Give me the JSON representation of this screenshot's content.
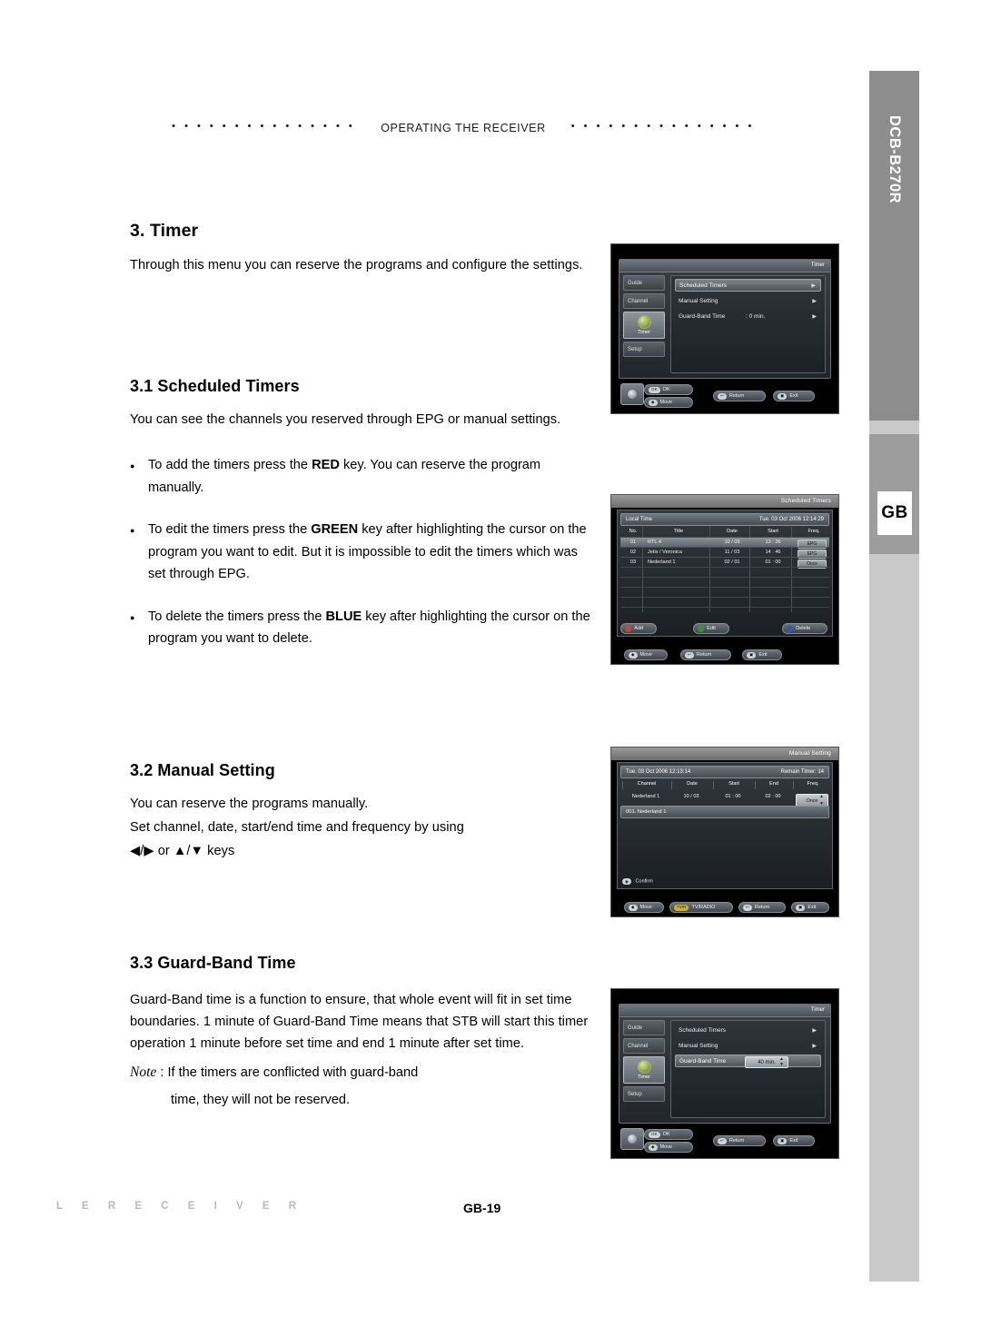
{
  "page": {
    "header_title": "OPERATING THE RECEIVER",
    "header_dots_left": "• • • • • • • • • • • • • • •",
    "header_dots_right": "• • • • • • • • • • • • • • •",
    "model": "DCB-B270R",
    "language_tab": "GB",
    "footer_left": "L  E      R  E  C  E  I  V  E  R",
    "footer_page": "GB-19"
  },
  "sections": {
    "timer": {
      "heading": "3. Timer",
      "body": "Through this menu you can reserve the programs and configure the settings."
    },
    "scheduled": {
      "heading": "3.1 Scheduled Timers",
      "body": "You can see the channels you reserved through EPG or manual settings.",
      "bullets": [
        {
          "pre": "To add the timers press the ",
          "kw": "RED",
          "post": " key. You can reserve the program manually."
        },
        {
          "pre": "To edit the timers press the ",
          "kw": "GREEN",
          "post": " key after highlighting the cursor on the program you want to edit. But it is impossible to edit the timers which was set through EPG."
        },
        {
          "pre": "To delete the timers press the ",
          "kw": "BLUE",
          "post": " key after highlighting the cursor on the program you want to delete."
        }
      ]
    },
    "manual": {
      "heading": "3.2 Manual Setting",
      "body1": "You can reserve the programs manually.",
      "body2": "Set channel, date, start/end time and frequency by using",
      "body3_keys": "◀/▶ or ▲/▼ keys"
    },
    "guard": {
      "heading": "3.3 Guard-Band Time",
      "body": "Guard-Band time is a function to ensure, that whole event will fit in set time boundaries. 1 minute of Guard-Band Time means that STB will start this timer operation 1 minute before set time and end 1 minute after set time.",
      "note_label": "Note",
      "note_colon": ":",
      "note_text": "If the timers are conflicted with guard-band",
      "note_text2": "time, they will not be reserved."
    }
  },
  "screenshots": {
    "timer_menu": {
      "window_title": "Timer",
      "tabs": [
        {
          "label": "Guide"
        },
        {
          "label": "Channel"
        },
        {
          "label": "Timer"
        },
        {
          "label": "Setup"
        }
      ],
      "rows": [
        {
          "label": "Scheduled Timers",
          "value": "",
          "arrow": "▶"
        },
        {
          "label": "Manual Setting",
          "value": "",
          "arrow": "▶"
        },
        {
          "label": "Guard-Band Time",
          "value": ": 0 min.",
          "arrow": "▶"
        }
      ],
      "nav": [
        {
          "key": "OK",
          "label": "OK"
        },
        {
          "key": "◆",
          "label": "Move"
        },
        {
          "key": "↩",
          "label": "Return"
        },
        {
          "key": "▣",
          "label": "Exit"
        }
      ]
    },
    "scheduled_timers": {
      "window_title": "Scheduled Timers",
      "local_time_label": "Local Time",
      "local_time_value": "Tue. 03 Oct 2006 12:14:29",
      "columns": [
        "No.",
        "Title",
        "Date",
        "Start",
        "Freq."
      ],
      "rows": [
        {
          "no": "01",
          "title": "RTL 4",
          "date": "10 / 03",
          "start": "13 : 26",
          "freq": "EPG",
          "selected": true
        },
        {
          "no": "02",
          "title": "Jetix / Veronica",
          "date": "11 / 03",
          "start": "14 : 46",
          "freq": "EPG",
          "selected": false
        },
        {
          "no": "03",
          "title": "Nederland 1",
          "date": "02 / 01",
          "start": "01 : 00",
          "freq": "Once",
          "selected": false
        }
      ],
      "actions": [
        {
          "key": "RED",
          "label": "Add"
        },
        {
          "key": "GREEN",
          "label": "Edit"
        },
        {
          "key": "BLUE",
          "label": "Delete"
        }
      ],
      "nav": [
        {
          "key": "◆",
          "label": "Move"
        },
        {
          "key": "↩",
          "label": "Return"
        },
        {
          "key": "▣",
          "label": "Exit"
        }
      ]
    },
    "manual_setting": {
      "window_title": "Manual Setting",
      "date_value": "Tue. 03 Oct 2006 12:13:14",
      "remain_label": "Remain Timer",
      "remain_value": ": 14",
      "columns": [
        "Channel",
        "Date",
        "Start",
        "End",
        "Freq."
      ],
      "row": {
        "channel": "Nederland 1",
        "date": "10 / 03",
        "start": "01 : 00",
        "end": "02 : 00",
        "freq": "Once"
      },
      "channel_line": "001. Nederland 1",
      "confirm_label": "Confirm",
      "nav": [
        {
          "key": "◆",
          "label": "Move"
        },
        {
          "key": "TV/RADIO",
          "label": "TV/RADIO"
        },
        {
          "key": "↩",
          "label": "Return"
        },
        {
          "key": "▣",
          "label": "Exit"
        }
      ]
    },
    "guard_band": {
      "window_title": "Timer",
      "tabs": [
        {
          "label": "Guide"
        },
        {
          "label": "Channel"
        },
        {
          "label": "Timer"
        },
        {
          "label": "Setup"
        }
      ],
      "rows": [
        {
          "label": "Scheduled Timers",
          "arrow": "▶"
        },
        {
          "label": "Manual Setting",
          "arrow": "▶"
        },
        {
          "label": "Guard-Band Time",
          "value": "40 min.",
          "arrow": ""
        }
      ],
      "nav": [
        {
          "key": "OK",
          "label": "OK"
        },
        {
          "key": "◆",
          "label": "Move"
        },
        {
          "key": "↩",
          "label": "Return"
        },
        {
          "key": "▣",
          "label": "Exit"
        }
      ]
    }
  }
}
